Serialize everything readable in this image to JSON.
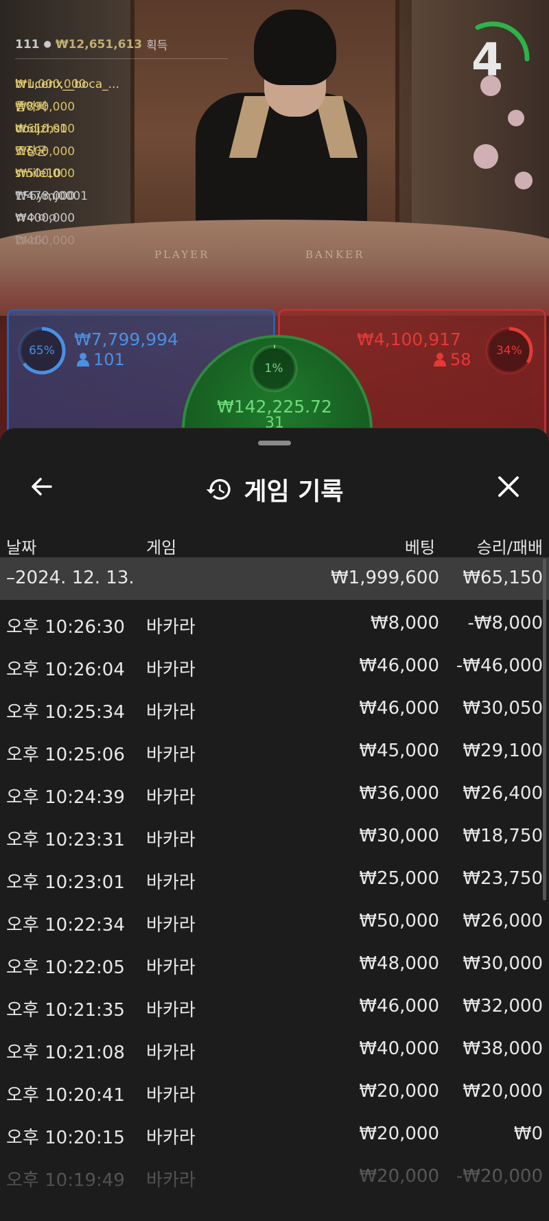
{
  "leaderboard": {
    "player_count": "111",
    "total": "₩12,651,613",
    "total_suffix": "획득",
    "entries": [
      {
        "amount": "₩1,000,000",
        "name": "brucenx__boca_..."
      },
      {
        "amount": "₩890,000",
        "name": "폼아빠"
      },
      {
        "amount": "₩610,000",
        "name": "dodjzhs1"
      },
      {
        "amount": "₩600,000",
        "name": "조장군"
      },
      {
        "amount": "₩500,000",
        "name": "smile10"
      },
      {
        "amount": "₩478,000",
        "name": "1F6ymj0001"
      },
      {
        "amount": "₩400,000",
        "name": "ㅇㅇㅇㅇ"
      },
      {
        "amount": "₩400,000",
        "name": "Dkdk"
      }
    ]
  },
  "countdown": {
    "value": "4"
  },
  "table": {
    "player_label": "PLAYER",
    "banker_label": "BANKER"
  },
  "bets": {
    "player": {
      "percent": "65%",
      "amount": "₩7,799,994",
      "count": "101",
      "fraction": 0.65,
      "color": "#4a90e2"
    },
    "banker": {
      "percent": "34%",
      "amount": "₩4,100,917",
      "count": "58",
      "fraction": 0.34,
      "color": "#e53935"
    },
    "tie": {
      "percent": "1%",
      "amount": "₩142,225.72",
      "count": "31",
      "fraction": 0.01,
      "color": "#6ddc7c"
    }
  },
  "sheet": {
    "title": "게임 기록",
    "columns": {
      "date": "날짜",
      "game": "게임",
      "bet": "베팅",
      "winloss": "승리/패배"
    },
    "summary": {
      "date": "–2024. 12. 13.",
      "bet": "₩1,999,600",
      "winloss": "₩65,150"
    },
    "rows": [
      {
        "time": "오후 10:26:30",
        "game": "바카라",
        "bet": "₩8,000",
        "winloss": "-₩8,000"
      },
      {
        "time": "오후 10:26:04",
        "game": "바카라",
        "bet": "₩46,000",
        "winloss": "-₩46,000"
      },
      {
        "time": "오후 10:25:34",
        "game": "바카라",
        "bet": "₩46,000",
        "winloss": "₩30,050"
      },
      {
        "time": "오후 10:25:06",
        "game": "바카라",
        "bet": "₩45,000",
        "winloss": "₩29,100"
      },
      {
        "time": "오후 10:24:39",
        "game": "바카라",
        "bet": "₩36,000",
        "winloss": "₩26,400"
      },
      {
        "time": "오후 10:23:31",
        "game": "바카라",
        "bet": "₩30,000",
        "winloss": "₩18,750"
      },
      {
        "time": "오후 10:23:01",
        "game": "바카라",
        "bet": "₩25,000",
        "winloss": "₩23,750"
      },
      {
        "time": "오후 10:22:34",
        "game": "바카라",
        "bet": "₩50,000",
        "winloss": "₩26,000"
      },
      {
        "time": "오후 10:22:05",
        "game": "바카라",
        "bet": "₩48,000",
        "winloss": "₩30,000"
      },
      {
        "time": "오후 10:21:35",
        "game": "바카라",
        "bet": "₩46,000",
        "winloss": "₩32,000"
      },
      {
        "time": "오후 10:21:08",
        "game": "바카라",
        "bet": "₩40,000",
        "winloss": "₩38,000"
      },
      {
        "time": "오후 10:20:41",
        "game": "바카라",
        "bet": "₩20,000",
        "winloss": "₩20,000"
      },
      {
        "time": "오후 10:20:15",
        "game": "바카라",
        "bet": "₩20,000",
        "winloss": "₩0"
      },
      {
        "time": "오후 10:19:49",
        "game": "바카라",
        "bet": "₩20,000",
        "winloss": "-₩20,000"
      }
    ]
  }
}
